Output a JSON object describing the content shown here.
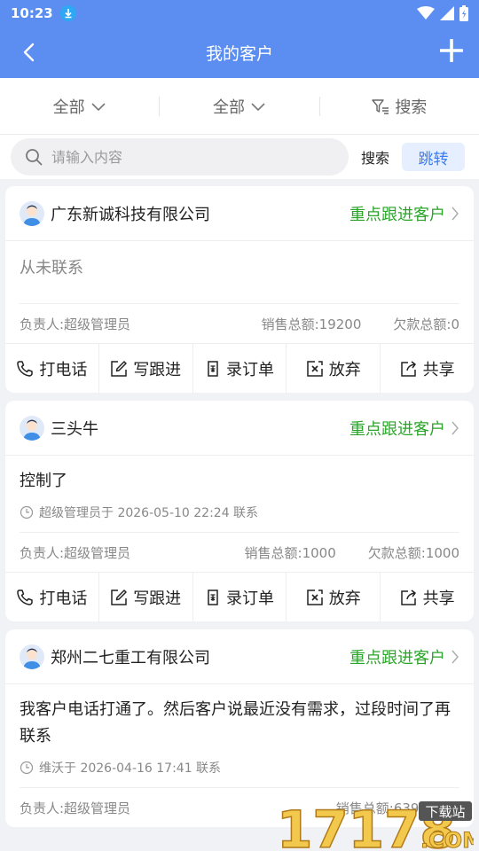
{
  "status_bar": {
    "time": "10:23"
  },
  "header": {
    "title": "我的客户"
  },
  "filters": [
    {
      "label": "全部"
    },
    {
      "label": "全部"
    },
    {
      "label": "搜索"
    }
  ],
  "search": {
    "placeholder": "请输入内容",
    "search_label": "搜索",
    "jump_label": "跳转"
  },
  "customers": [
    {
      "name": "广东新诚科技有限公司",
      "tag": "重点跟进客户",
      "note": "从未联系",
      "contact": "",
      "owner": "负责人:超级管理员",
      "sales": "销售总额:19200",
      "debt": "欠款总额:0"
    },
    {
      "name": "三头牛",
      "tag": "重点跟进客户",
      "note": "控制了",
      "contact": "超级管理员于 2026-05-10 22:24 联系",
      "owner": "负责人:超级管理员",
      "sales": "销售总额:1000",
      "debt": "欠款总额:1000"
    },
    {
      "name": "郑州二七重工有限公司",
      "tag": "重点跟进客户",
      "note": "我客户电话打通了。然后客户说最近没有需求，过段时间了再联系",
      "contact": "维沃于 2026-04-16 17:41 联系",
      "owner": "负责人:超级管理员",
      "sales": "销售总额:6398",
      "debt": ""
    }
  ],
  "actions": [
    "打电话",
    "写跟进",
    "录订单",
    "放弃",
    "共享"
  ],
  "watermark": {
    "text": "17178",
    "badge": "下载站",
    "suffix": ".COM"
  },
  "colors": {
    "header_bg": "#5b8ef0",
    "tag_green": "#2aa52a",
    "jump_blue": "#3b7cf0"
  },
  "icons": [
    "download-icon",
    "wifi-icon",
    "signal-icon",
    "battery-icon",
    "back-arrow-icon",
    "plus-icon",
    "chevron-down-icon",
    "filter-icon",
    "search-icon",
    "avatar-icon",
    "chevron-right-icon",
    "clock-icon",
    "phone-icon",
    "edit-icon",
    "order-icon",
    "abandon-icon",
    "share-icon"
  ]
}
